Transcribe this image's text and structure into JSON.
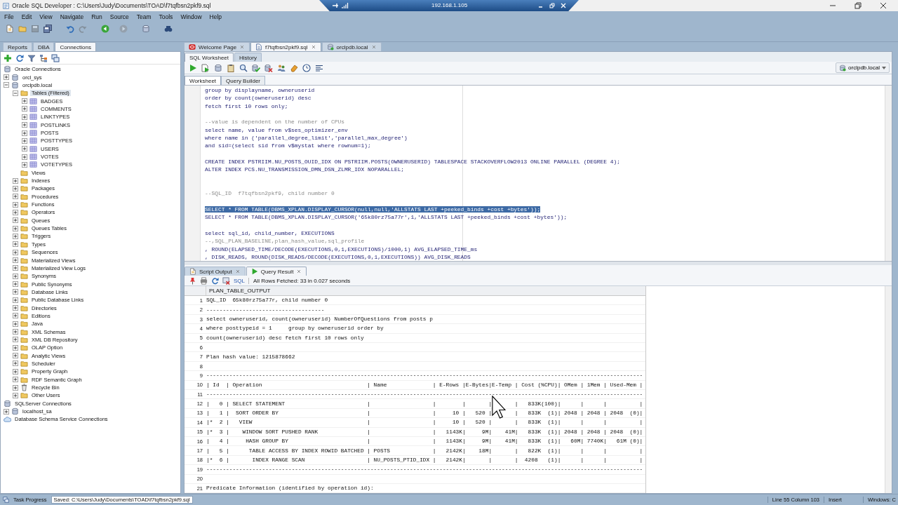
{
  "window": {
    "title": "Oracle SQL Developer : C:\\Users\\Judy\\Documents\\TOAD\\f7tqfbsn2pkf9.sql"
  },
  "remote_bar": {
    "address": "192.168.1.105"
  },
  "menu": [
    "File",
    "Edit",
    "View",
    "Navigate",
    "Run",
    "Source",
    "Team",
    "Tools",
    "Window",
    "Help"
  ],
  "main_toolbar": [
    {
      "kind": "document",
      "disabled": false
    },
    {
      "kind": "folder",
      "disabled": false
    },
    {
      "kind": "floppy",
      "disabled": true
    },
    {
      "kind": "floppies",
      "disabled": false
    },
    {
      "kind": "undo",
      "disabled": false
    },
    {
      "kind": "redo",
      "disabled": true
    },
    {
      "kind": "back",
      "disabled": false
    },
    {
      "kind": "forward",
      "disabled": true
    },
    {
      "kind": "database",
      "disabled": false
    },
    {
      "kind": "binoculars",
      "disabled": false
    }
  ],
  "navigator": {
    "tabs": [
      {
        "label": "Reports",
        "selected": false
      },
      {
        "label": "DBA",
        "selected": false
      },
      {
        "label": "Connections",
        "selected": true
      }
    ],
    "toolbar": [
      {
        "kind": "plus"
      },
      {
        "kind": "refresh"
      },
      {
        "kind": "filter"
      },
      {
        "kind": "hierarchy"
      },
      {
        "kind": "windows"
      }
    ],
    "tree": [
      {
        "label": "Oracle Connections",
        "kind": "database",
        "expanded": true,
        "selected": false,
        "children": [
          {
            "label": "orcl_sys",
            "kind": "database",
            "expanded": false,
            "selected": false
          },
          {
            "label": "orclpdb.local",
            "kind": "database",
            "expanded": true,
            "selected": false,
            "children": [
              {
                "label": "Tables (Filtered)",
                "kind": "folder",
                "expanded": true,
                "selected": true,
                "children": [
                  {
                    "label": "BADGES",
                    "kind": "table",
                    "expanded": false,
                    "selected": false
                  },
                  {
                    "label": "COMMENTS",
                    "kind": "table",
                    "expanded": false,
                    "selected": false
                  },
                  {
                    "label": "LINKTYPES",
                    "kind": "table",
                    "expanded": false,
                    "selected": false
                  },
                  {
                    "label": "POSTLINKS",
                    "kind": "table",
                    "expanded": false,
                    "selected": false
                  },
                  {
                    "label": "POSTS",
                    "kind": "table",
                    "expanded": false,
                    "selected": false
                  },
                  {
                    "label": "POSTTYPES",
                    "kind": "table",
                    "expanded": false,
                    "selected": false
                  },
                  {
                    "label": "USERS",
                    "kind": "table",
                    "expanded": false,
                    "selected": false
                  },
                  {
                    "label": "VOTES",
                    "kind": "table",
                    "expanded": false,
                    "selected": false
                  },
                  {
                    "label": "VOTETYPES",
                    "kind": "table",
                    "expanded": false,
                    "selected": false
                  }
                ]
              },
              {
                "label": "Views",
                "kind": "empty-folder",
                "selected": false
              },
              {
                "label": "Indexes",
                "kind": "folder",
                "expanded": false,
                "selected": false
              },
              {
                "label": "Packages",
                "kind": "folder",
                "expanded": false,
                "selected": false
              },
              {
                "label": "Procedures",
                "kind": "folder",
                "expanded": false,
                "selected": false
              },
              {
                "label": "Functions",
                "kind": "folder",
                "expanded": false,
                "selected": false
              },
              {
                "label": "Operators",
                "kind": "folder",
                "expanded": false,
                "selected": false
              },
              {
                "label": "Queues",
                "kind": "folder",
                "expanded": false,
                "selected": false
              },
              {
                "label": "Queues Tables",
                "kind": "folder",
                "expanded": false,
                "selected": false
              },
              {
                "label": "Triggers",
                "kind": "folder",
                "expanded": false,
                "selected": false
              },
              {
                "label": "Types",
                "kind": "folder",
                "expanded": false,
                "selected": false
              },
              {
                "label": "Sequences",
                "kind": "folder",
                "expanded": false,
                "selected": false
              },
              {
                "label": "Materialized Views",
                "kind": "folder",
                "expanded": false,
                "selected": false
              },
              {
                "label": "Materialized View Logs",
                "kind": "folder",
                "expanded": false,
                "selected": false
              },
              {
                "label": "Synonyms",
                "kind": "folder",
                "expanded": false,
                "selected": false
              },
              {
                "label": "Public Synonyms",
                "kind": "folder",
                "expanded": false,
                "selected": false
              },
              {
                "label": "Database Links",
                "kind": "folder",
                "expanded": false,
                "selected": false
              },
              {
                "label": "Public Database Links",
                "kind": "folder",
                "expanded": false,
                "selected": false
              },
              {
                "label": "Directories",
                "kind": "folder",
                "expanded": false,
                "selected": false
              },
              {
                "label": "Editions",
                "kind": "folder",
                "expanded": false,
                "selected": false
              },
              {
                "label": "Java",
                "kind": "folder",
                "expanded": false,
                "selected": false
              },
              {
                "label": "XML Schemas",
                "kind": "folder",
                "expanded": false,
                "selected": false
              },
              {
                "label": "XML DB Repository",
                "kind": "folder",
                "expanded": false,
                "selected": false
              },
              {
                "label": "OLAP Option",
                "kind": "folder",
                "expanded": false,
                "selected": false
              },
              {
                "label": "Analytic Views",
                "kind": "folder",
                "expanded": false,
                "selected": false
              },
              {
                "label": "Scheduler",
                "kind": "folder",
                "expanded": false,
                "selected": false
              },
              {
                "label": "Property Graph",
                "kind": "folder",
                "expanded": false,
                "selected": false
              },
              {
                "label": "RDF Semantic Graph",
                "kind": "folder",
                "expanded": false,
                "selected": false
              },
              {
                "label": "Recycle Bin",
                "kind": "trash",
                "expanded": false,
                "selected": false
              },
              {
                "label": "Other Users",
                "kind": "folder",
                "expanded": false,
                "selected": false
              }
            ]
          }
        ]
      },
      {
        "label": "SQLServer Connections",
        "kind": "database",
        "expanded": true,
        "selected": false,
        "children": [
          {
            "label": "localhost_sa",
            "kind": "database",
            "expanded": false,
            "selected": false
          }
        ]
      },
      {
        "label": "Database Schema Service Connections",
        "kind": "cloud",
        "selected": false
      }
    ]
  },
  "editor": {
    "tabs": [
      {
        "label": "Welcome Page",
        "kind": "welcome",
        "selected": false
      },
      {
        "label": "f7tqfbsn2pkf9.sql",
        "kind": "sql",
        "selected": true
      },
      {
        "label": "orclpdb.local",
        "kind": "connection",
        "selected": false
      }
    ],
    "subtabs": [
      {
        "label": "SQL Worksheet",
        "selected": true
      },
      {
        "label": "History",
        "selected": false
      }
    ],
    "toolbar": [
      {
        "kind": "play"
      },
      {
        "kind": "script"
      },
      {
        "kind": "database"
      },
      {
        "kind": "clipboard"
      },
      {
        "kind": "search"
      },
      {
        "kind": "commit"
      },
      {
        "kind": "rollback"
      },
      {
        "kind": "people"
      },
      {
        "kind": "eraser"
      },
      {
        "kind": "clock"
      },
      {
        "kind": "lines"
      }
    ],
    "connection": "orclpdb.local",
    "view_tabs": [
      {
        "label": "Worksheet",
        "selected": true
      },
      {
        "label": "Query Builder",
        "selected": false
      }
    ],
    "lines": [
      {
        "kind": "code",
        "text": "group by displayname, owneruserid",
        "selected": false
      },
      {
        "kind": "code",
        "text": "order by count(owneruserid) desc",
        "selected": false
      },
      {
        "kind": "code",
        "text": "fetch first 10 rows only;",
        "selected": false
      },
      {
        "kind": "blank"
      },
      {
        "kind": "comment",
        "text": "--value is dependent on the number of CPUs",
        "selected": false
      },
      {
        "kind": "code",
        "text": "select name, value from v$ses_optimizer_env",
        "selected": false
      },
      {
        "kind": "code",
        "text": "where name in ('parallel_degree_limit','parallel_max_degree')",
        "selected": false
      },
      {
        "kind": "code",
        "text": "and sid=(select sid from v$mystat where rownum=1);",
        "selected": false
      },
      {
        "kind": "blank"
      },
      {
        "kind": "code",
        "text": "CREATE INDEX PSTRIIM.NU_POSTS_OUID_IDX ON PSTRIIM.POSTS(OWNERUSERID) TABLESPACE STACKOVERFLOW2013 ONLINE PARALLEL (DEGREE 4);",
        "selected": false
      },
      {
        "kind": "code",
        "text": "ALTER INDEX PCS.NU_TRANSMISSION_DMN_DSN_ZLMR_IDX NOPARALLEL;",
        "selected": false
      },
      {
        "kind": "blank"
      },
      {
        "kind": "blank"
      },
      {
        "kind": "comment",
        "text": "--SQL_ID  f7tqfbsn2pkf9, child number 0",
        "selected": false
      },
      {
        "kind": "blank"
      },
      {
        "kind": "code",
        "text": "SELECT * FROM TABLE(DBMS_XPLAN.DISPLAY_CURSOR(null,null,'ALLSTATS LAST +peeked_binds +cost +bytes'));",
        "selected": true
      },
      {
        "kind": "code",
        "text": "SELECT * FROM TABLE(DBMS_XPLAN.DISPLAY_CURSOR('65k80rz75a77r',1,'ALLSTATS LAST +peeked_binds +cost +bytes'));",
        "selected": false
      },
      {
        "kind": "blank"
      },
      {
        "kind": "code",
        "text": "select sql_id, child_number, EXECUTIONS",
        "selected": false
      },
      {
        "kind": "comment",
        "text": "--,SQL_PLAN_BASELINE,plan_hash_value,sql_profile",
        "selected": false
      },
      {
        "kind": "code",
        "text": ", ROUND(ELAPSED_TIME/DECODE(EXECUTIONS,0,1,EXECUTIONS)/1000,1) AVG_ELAPSED_TIME_ms",
        "selected": false
      },
      {
        "kind": "code",
        "text": ", DISK_READS, ROUND(DISK_READS/DECODE(EXECUTIONS,0,1,EXECUTIONS)) AVG_DISK_READS",
        "selected": false
      }
    ]
  },
  "results": {
    "tabs": [
      {
        "label": "Script Output",
        "kind": "script",
        "selected": false
      },
      {
        "label": "Query Result",
        "kind": "play",
        "selected": true
      }
    ],
    "toolbar": [
      {
        "kind": "pin"
      },
      {
        "kind": "printer"
      },
      {
        "kind": "refresh"
      },
      {
        "kind": "delete"
      }
    ],
    "sql_link": "SQL",
    "message": "All Rows Fetched: 33 in 0.027 seconds",
    "column": "PLAN_TABLE_OUTPUT",
    "rows": [
      {
        "n": "1",
        "text": "SQL_ID  65k80rz75a77r, child number 0"
      },
      {
        "n": "2",
        "text": "------------------------------------"
      },
      {
        "n": "3",
        "text": "select owneruserid, count(owneruserid) NumberOfQuestions from posts p"
      },
      {
        "n": "4",
        "text": "where posttypeid = 1     group by owneruserid order by"
      },
      {
        "n": "5",
        "text": "count(owneruserid) desc fetch first 10 rows only"
      },
      {
        "n": "6"
      },
      {
        "n": "7",
        "text": "Plan hash value: 1215878662"
      },
      {
        "n": "8"
      },
      {
        "n": "9",
        "text": "-------------------------------------------------------------------------------------------------------------------------------------"
      },
      {
        "n": "10",
        "text": "| Id  | Operation                                | Name              | E-Rows |E-Bytes|E-Temp | Cost (%CPU)| OMem | 1Mem | Used-Mem |"
      },
      {
        "n": "11",
        "text": "-------------------------------------------------------------------------------------------------------------------------------------"
      },
      {
        "n": "12",
        "text": "|   0 | SELECT STATEMENT                         |                   |        |       |       |   833K(100)|      |      |          |"
      },
      {
        "n": "13",
        "text": "|   1 |  SORT ORDER BY                           |                   |     10 |   520 |       |   833K  (1)| 2048 | 2048 | 2048  (0)|"
      },
      {
        "n": "14",
        "text": "|*  2 |   VIEW                                   |                   |     10 |   520 |       |   833K  (1)|      |      |          |"
      },
      {
        "n": "15",
        "text": "|*  3 |    WINDOW SORT PUSHED RANK               |                   |   1143K|     9M|    41M|   833K  (1)| 2048 | 2048 | 2048  (0)|"
      },
      {
        "n": "16",
        "text": "|   4 |     HASH GROUP BY                        |                   |   1143K|     9M|    41M|   833K  (1)|   60M| 7740K|   61M (0)|"
      },
      {
        "n": "17",
        "text": "|   5 |      TABLE ACCESS BY INDEX ROWID BATCHED | POSTS             |   2142K|    18M|       |   822K  (1)|      |      |          |"
      },
      {
        "n": "18",
        "text": "|*  6 |       INDEX RANGE SCAN                   | NU_POSTS_PTID_IDX |   2142K|       |       |  4208   (1)|      |      |          |"
      },
      {
        "n": "19",
        "text": "-------------------------------------------------------------------------------------------------------------------------------------"
      },
      {
        "n": "20"
      },
      {
        "n": "21",
        "text": "Predicate Information (identified by operation id):"
      }
    ]
  },
  "status_bar": {
    "task": "Task Progress",
    "message": "Saved: C:\\Users\\Judy\\Documents\\TOAD\\f7tqfbsn2pkf9.sql",
    "position": "Line 55 Column 103",
    "mode": "Insert",
    "line_endings": "Windows: C"
  }
}
